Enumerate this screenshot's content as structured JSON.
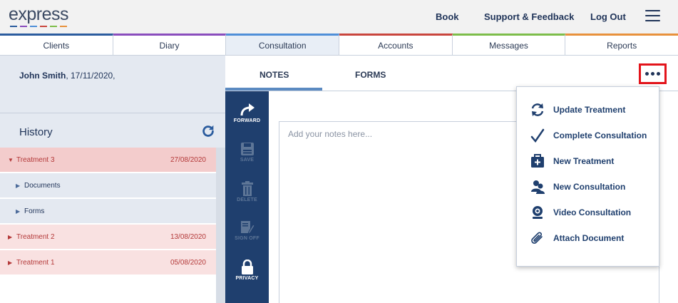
{
  "header": {
    "logo_text": "express",
    "logo_colors": [
      "#2b5c9e",
      "#8a4dbd",
      "#4f8fd8",
      "#c9463d",
      "#7dbd4a",
      "#e8913c"
    ],
    "links": [
      "Book",
      "Support & Feedback",
      "Log Out"
    ],
    "menu_icon": "hamburger-icon"
  },
  "tabs": [
    {
      "label": "Clients",
      "color": "#2b5c9e"
    },
    {
      "label": "Diary",
      "color": "#8a4dbd"
    },
    {
      "label": "Consultation",
      "color": "#4f8fd8",
      "active": true
    },
    {
      "label": "Accounts",
      "color": "#c9463d"
    },
    {
      "label": "Messages",
      "color": "#7dbd4a"
    },
    {
      "label": "Reports",
      "color": "#e8913c"
    }
  ],
  "patient": {
    "name": "John Smith",
    "details": ", 17/11/2020,"
  },
  "history": {
    "title": "History",
    "rows": [
      {
        "label": "Treatment 3",
        "date": "27/08/2020",
        "type": "treatment",
        "expanded": true
      },
      {
        "label": "Documents",
        "date": "",
        "type": "sub"
      },
      {
        "label": "Forms",
        "date": "",
        "type": "sub"
      },
      {
        "label": "Treatment 2",
        "date": "13/08/2020",
        "type": "treatment",
        "expanded": false
      },
      {
        "label": "Treatment 1",
        "date": "05/08/2020",
        "type": "treatment",
        "expanded": false
      }
    ]
  },
  "subtabs": {
    "notes": "NOTES",
    "forms": "FORMS"
  },
  "toolbar": {
    "forward": "FORWARD",
    "save": "SAVE",
    "delete": "DELETE",
    "sign_off": "SIGN OFF",
    "privacy": "PRIVACY"
  },
  "notes": {
    "placeholder": "Add your notes here..."
  },
  "dropdown": [
    {
      "label": "Update Treatment",
      "icon": "refresh-icon"
    },
    {
      "label": "Complete Consultation",
      "icon": "checkmark-icon"
    },
    {
      "label": "New Treatment",
      "icon": "medical-kit-icon"
    },
    {
      "label": "New Consultation",
      "icon": "people-icon"
    },
    {
      "label": "Video Consultation",
      "icon": "webcam-icon"
    },
    {
      "label": "Attach Document",
      "icon": "paperclip-icon"
    }
  ],
  "colors": {
    "accent": "#1f3f6e",
    "highlight": "#e3141b",
    "treatment_text": "#b43a3a"
  }
}
